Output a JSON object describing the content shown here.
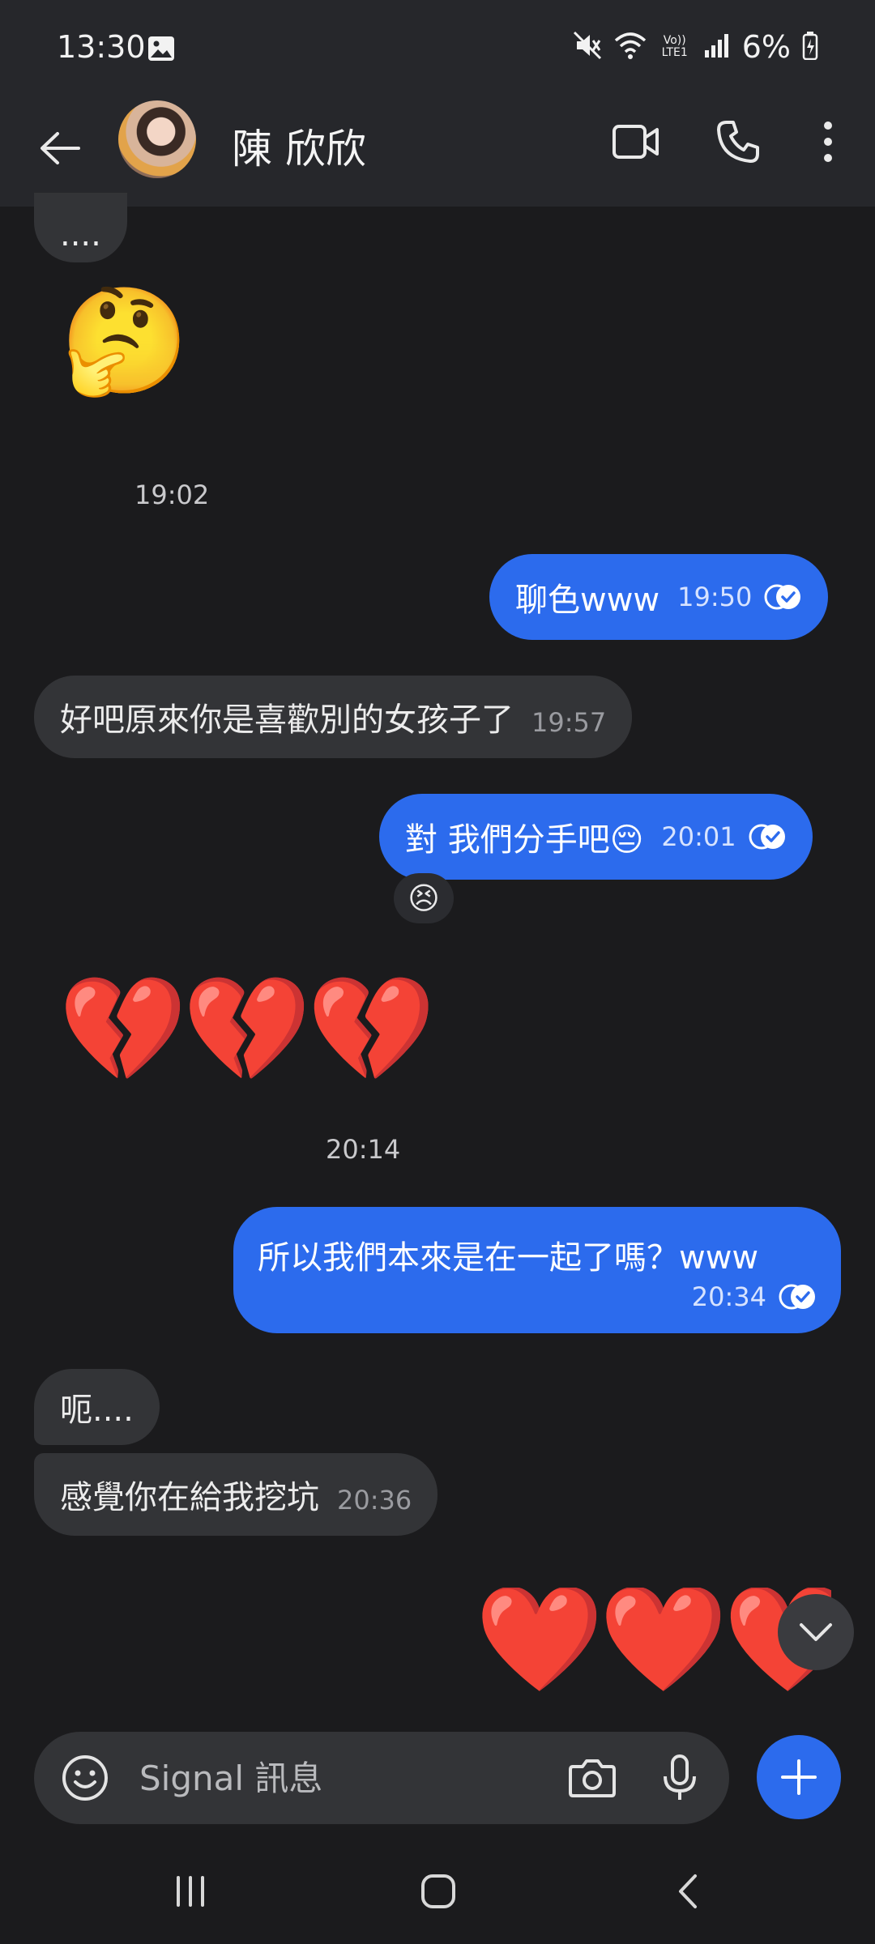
{
  "status_bar": {
    "time": "13:30",
    "network_label": "Vo)) LTE1",
    "battery": "6%"
  },
  "header": {
    "contact_name": "陳 欣欣"
  },
  "messages": {
    "m0_text": "....",
    "m1_emoji": "🤔",
    "m1_time": "19:02",
    "m2_text": "聊色www",
    "m2_time": "19:50",
    "m3_text": "好吧原來你是喜歡別的女孩子了",
    "m3_time": "19:57",
    "m4_text": "對 我們分手吧😔",
    "m4_time": "20:01",
    "m4_reaction": "😣",
    "m5_emoji": "💔💔💔",
    "m5_time": "20:14",
    "m6_text": "所以我們本來是在一起了嗎？www",
    "m6_time": "20:34",
    "m7_text": "呃....",
    "m8_text": "感覺你在給我挖坑",
    "m8_time": "20:36",
    "m9_emoji": "❤️❤️❤️"
  },
  "composer": {
    "placeholder": "Signal 訊息"
  },
  "colors": {
    "outgoing_bubble": "#2c6bed",
    "incoming_bubble": "#333437",
    "background": "#1b1b1d"
  },
  "icons": [
    "back-arrow-icon",
    "video-call-icon",
    "phone-icon",
    "more-vert-icon",
    "emoji-icon",
    "camera-icon",
    "mic-icon",
    "plus-icon",
    "chevron-down-icon",
    "read-receipt-icon"
  ]
}
